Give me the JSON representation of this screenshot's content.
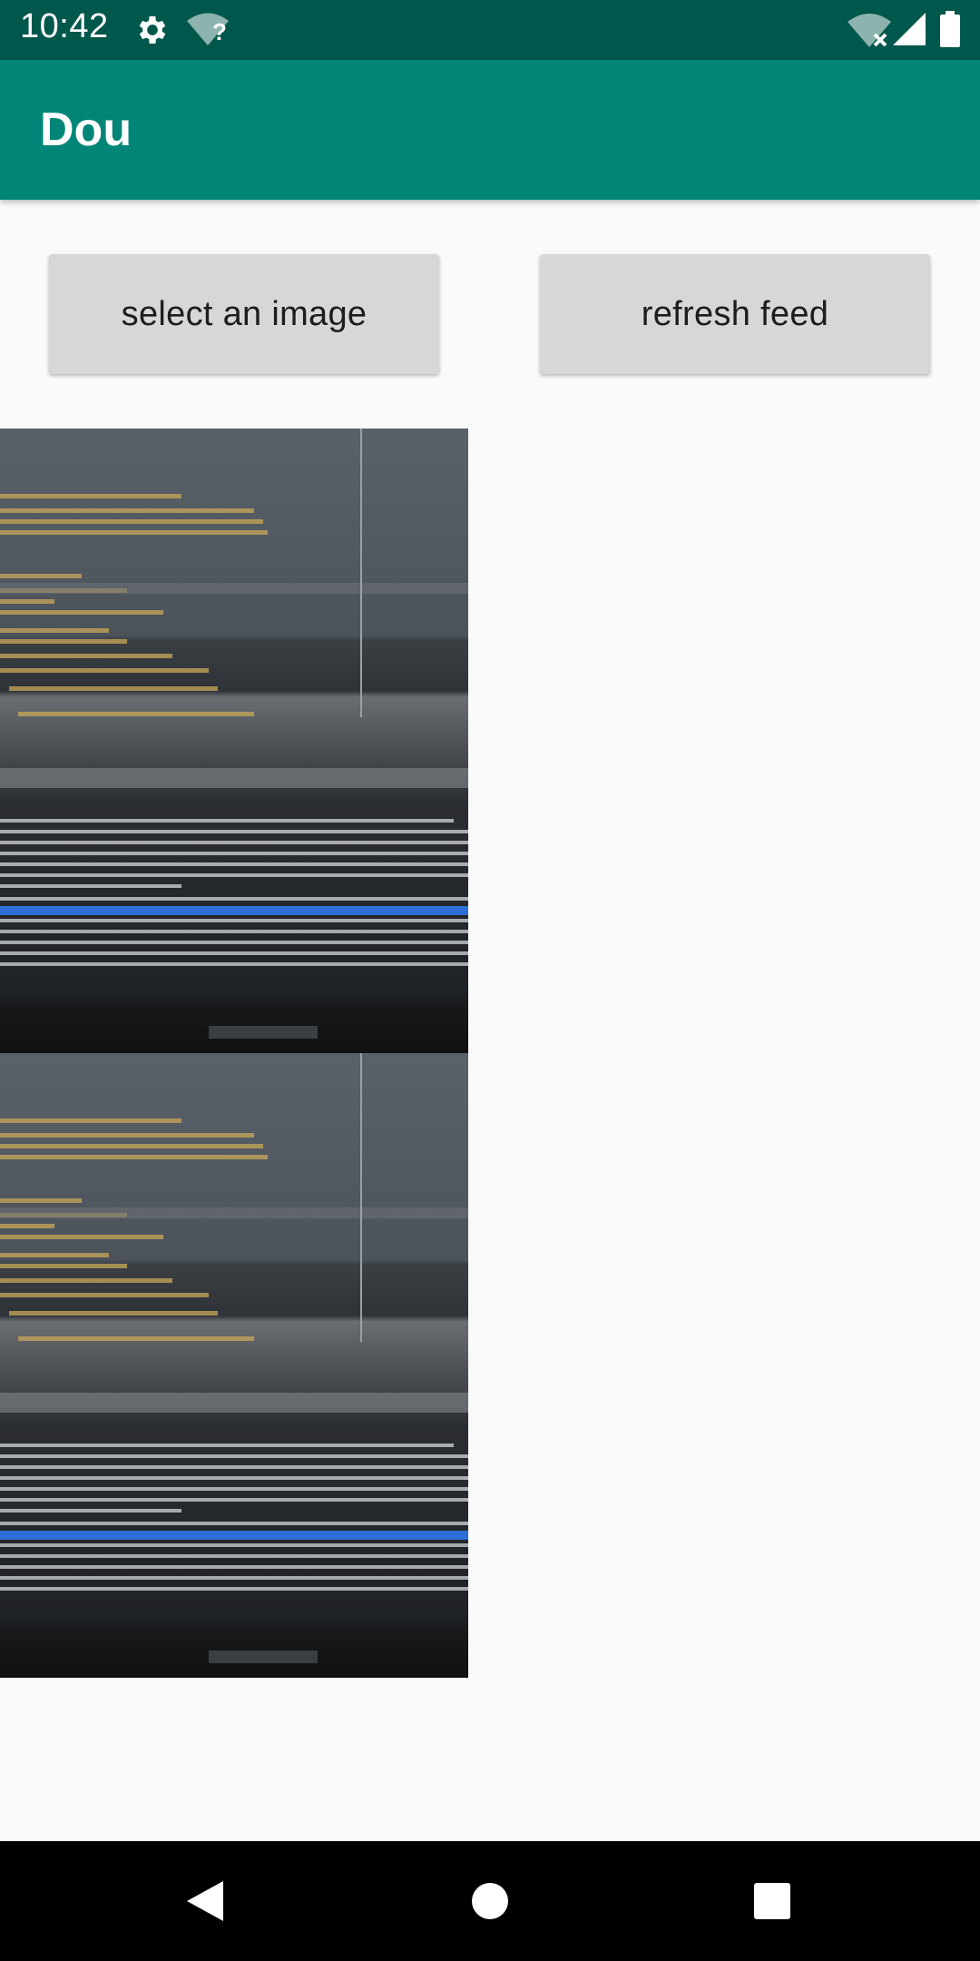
{
  "status_bar": {
    "time": "10:42",
    "icons": [
      "settings-icon",
      "wifi-unknown-icon",
      "wifi-no-internet-icon",
      "cell-signal-icon",
      "battery-icon"
    ],
    "wifi_unknown_mark": "?"
  },
  "app_bar": {
    "title": "Dou",
    "color": "#008577",
    "status_color": "#00574b"
  },
  "actions": {
    "select_label": "select an image",
    "refresh_label": "refresh feed"
  },
  "feed": {
    "images": [
      {
        "subject": "photo of laptop screen showing code and logcat"
      },
      {
        "subject": "photo of laptop screen showing code and logcat"
      }
    ]
  },
  "nav_bar": {
    "icons": [
      "back-icon",
      "home-icon",
      "recents-icon"
    ]
  }
}
